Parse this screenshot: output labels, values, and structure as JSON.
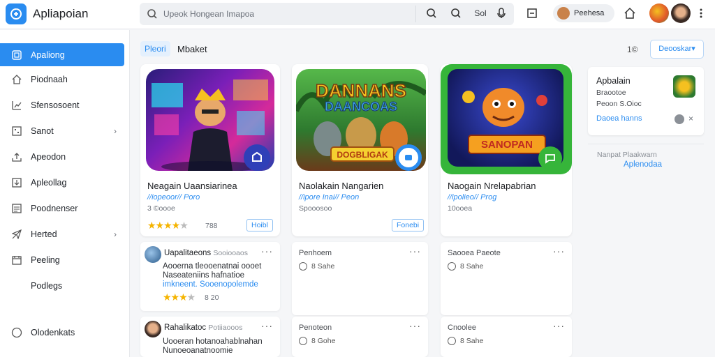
{
  "app": {
    "title": "Apliapoian"
  },
  "search": {
    "placeholder": "Upeok Hongean Imapoa",
    "extra": "Sol"
  },
  "user": {
    "name": "Peehesa"
  },
  "sidebar": {
    "items": [
      {
        "label": "Apaliong",
        "icon": "apps-icon",
        "active": true
      },
      {
        "label": "Piodnaah",
        "icon": "home-icon"
      },
      {
        "label": "Sfensosoent",
        "icon": "chart-icon"
      },
      {
        "label": "Sanot",
        "icon": "grid-icon",
        "chevron": true
      },
      {
        "label": "Apeodon",
        "icon": "upload-icon"
      },
      {
        "label": "Apleollag",
        "icon": "download-icon"
      },
      {
        "label": "Poodnenser",
        "icon": "list-icon"
      },
      {
        "label": "Herted",
        "icon": "send-icon",
        "chevron": true
      },
      {
        "label": "Peeling",
        "icon": "calendar-icon"
      },
      {
        "label": "Podlegs",
        "icon": ""
      },
      {
        "label": "Olodenkats",
        "icon": "circle-icon"
      }
    ]
  },
  "main": {
    "pill": "Pleori",
    "title": "Mbaket",
    "count": "1©",
    "dropdown": "Deooskar▾"
  },
  "apps": [
    {
      "name": "Neagain Uaansiarinea",
      "category": "//iopeoor// Poro",
      "meta": "3 ©oooe",
      "rating": 4,
      "rating_text": "788",
      "button": "Hoibl",
      "badge_color": "#2f3fb8"
    },
    {
      "name": "Naolakain Nangarien",
      "category": "//ipore Inai// Peon",
      "meta": "Spooosoo",
      "button": "Fonebi",
      "badge_color": "#2a8cf0"
    },
    {
      "name": "Naogain Nrelapabrian",
      "category": "//ipolieo// Prog",
      "meta": "10ooea",
      "badge_color": "#2fb54a"
    }
  ],
  "game_art": [
    {
      "title": "",
      "subtitle": ""
    },
    {
      "title": "DANNANS",
      "subtitle": "DAANCOAS",
      "banner": "DOGBLIGAK"
    },
    {
      "title": "SANOPAN",
      "subtitle": ""
    }
  ],
  "posts": [
    {
      "author": "Uapalitaeons",
      "sub": "Sooiooaos",
      "lines": [
        "Aooerna tleooenatnai oooet",
        "Naseateniins hafnatioe",
        "imkneent. Sooenopolemde"
      ],
      "rating": 3,
      "rating_text": "8 20"
    },
    {
      "author": "Rahalikatoc",
      "sub": "Potiiaooos",
      "lines": [
        "Uooeran hotanoahablnahan",
        "Nunoeoanatnoomie"
      ]
    }
  ],
  "small_cards": [
    {
      "title": "Penhoem",
      "time": "8 Sahe"
    },
    {
      "title": "Saooea Paeote",
      "time": "8 Sahe"
    },
    {
      "title": "Penoteon",
      "time": "8 Gohe"
    },
    {
      "title": "Cnoolee",
      "time": "8 Sahe"
    }
  ],
  "right_panel": {
    "title": "Apbalain",
    "sub1": "Braootoe",
    "sub2": "Peoon S.Oioc",
    "link": "Daoea hanns",
    "section_label": "Nanpat Plaakwarn",
    "section_link": "Aplenodaa"
  }
}
